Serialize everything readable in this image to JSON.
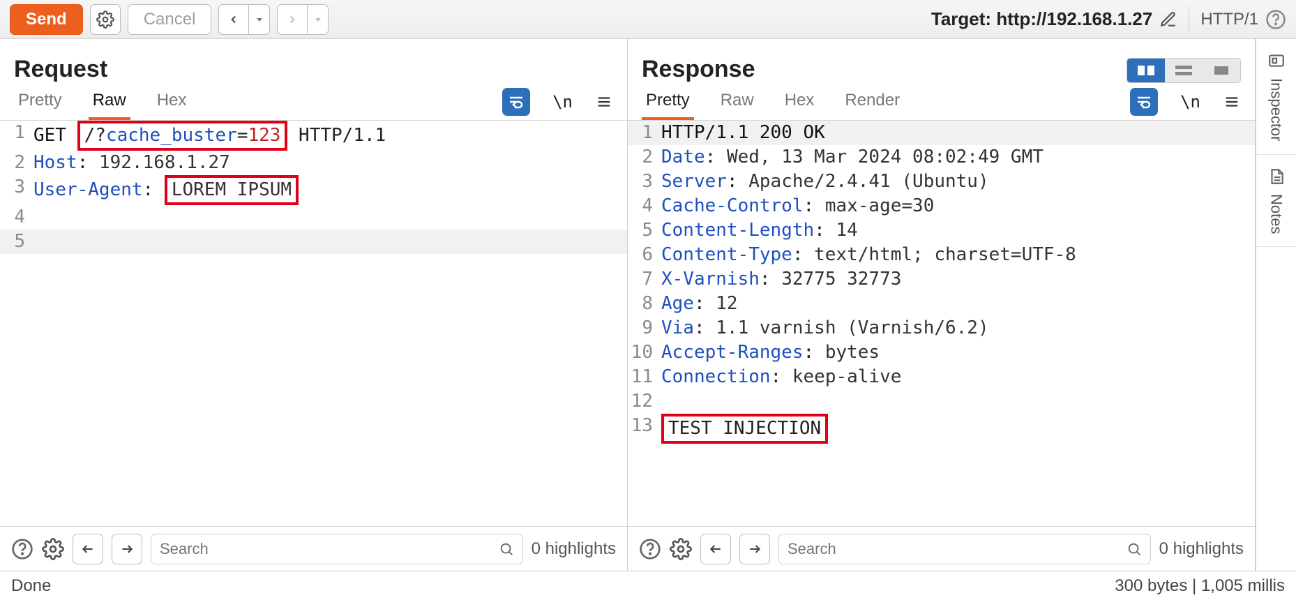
{
  "toolbar": {
    "send_label": "Send",
    "cancel_label": "Cancel",
    "target_prefix": "Target: ",
    "target_url": "http://192.168.1.27",
    "http_version": "HTTP/1"
  },
  "request": {
    "title": "Request",
    "tabs": {
      "pretty": "Pretty",
      "raw": "Raw",
      "hex": "Hex"
    },
    "active_tab": "Raw",
    "escape_label": "\\n",
    "lines": [
      {
        "n": 1,
        "segments": [
          {
            "t": "GET ",
            "cls": "kw-method"
          },
          {
            "hl": true,
            "segments": [
              {
                "t": "/?",
                "cls": ""
              },
              {
                "t": "cache_buster",
                "cls": "kw-url"
              },
              {
                "t": "=",
                "cls": ""
              },
              {
                "t": "123",
                "cls": "kw-num"
              }
            ]
          },
          {
            "t": " HTTP/1.1",
            "cls": ""
          }
        ]
      },
      {
        "n": 2,
        "segments": [
          {
            "t": "Host",
            "cls": "kw-header"
          },
          {
            "t": ": ",
            "cls": ""
          },
          {
            "t": "192.168.1.27",
            "cls": "kw-val"
          }
        ]
      },
      {
        "n": 3,
        "segments": [
          {
            "t": "User-Agent",
            "cls": "kw-header"
          },
          {
            "t": ": ",
            "cls": ""
          },
          {
            "hl": true,
            "segments": [
              {
                "t": "LOREM IPSUM",
                "cls": "kw-val"
              }
            ]
          }
        ]
      },
      {
        "n": 4,
        "segments": []
      },
      {
        "n": 5,
        "segments": [],
        "alt": true
      }
    ],
    "search_placeholder": "Search",
    "highlight_count": "0 highlights"
  },
  "response": {
    "title": "Response",
    "tabs": {
      "pretty": "Pretty",
      "raw": "Raw",
      "hex": "Hex",
      "render": "Render"
    },
    "active_tab": "Pretty",
    "escape_label": "\\n",
    "lines": [
      {
        "n": 1,
        "alt": true,
        "segments": [
          {
            "t": "HTTP/1.1 200 OK",
            "cls": "kw-status"
          }
        ]
      },
      {
        "n": 2,
        "segments": [
          {
            "t": "Date",
            "cls": "kw-header"
          },
          {
            "t": ": ",
            "cls": ""
          },
          {
            "t": "Wed, 13 Mar 2024 08:02:49 GMT",
            "cls": "kw-val"
          }
        ]
      },
      {
        "n": 3,
        "segments": [
          {
            "t": "Server",
            "cls": "kw-header"
          },
          {
            "t": ": ",
            "cls": ""
          },
          {
            "t": "Apache/2.4.41 (Ubuntu)",
            "cls": "kw-val"
          }
        ]
      },
      {
        "n": 4,
        "segments": [
          {
            "t": "Cache-Control",
            "cls": "kw-header"
          },
          {
            "t": ": ",
            "cls": ""
          },
          {
            "t": "max-age=30",
            "cls": "kw-val"
          }
        ]
      },
      {
        "n": 5,
        "segments": [
          {
            "t": "Content-Length",
            "cls": "kw-header"
          },
          {
            "t": ": ",
            "cls": ""
          },
          {
            "t": "14",
            "cls": "kw-val"
          }
        ]
      },
      {
        "n": 6,
        "segments": [
          {
            "t": "Content-Type",
            "cls": "kw-header"
          },
          {
            "t": ": ",
            "cls": ""
          },
          {
            "t": "text/html; charset=UTF-8",
            "cls": "kw-val"
          }
        ]
      },
      {
        "n": 7,
        "segments": [
          {
            "t": "X-Varnish",
            "cls": "kw-header"
          },
          {
            "t": ": ",
            "cls": ""
          },
          {
            "t": "32775 32773",
            "cls": "kw-val"
          }
        ]
      },
      {
        "n": 8,
        "segments": [
          {
            "t": "Age",
            "cls": "kw-header"
          },
          {
            "t": ": ",
            "cls": ""
          },
          {
            "t": "12",
            "cls": "kw-val"
          }
        ]
      },
      {
        "n": 9,
        "segments": [
          {
            "t": "Via",
            "cls": "kw-header"
          },
          {
            "t": ": ",
            "cls": ""
          },
          {
            "t": "1.1 varnish (Varnish/6.2)",
            "cls": "kw-val"
          }
        ]
      },
      {
        "n": 10,
        "segments": [
          {
            "t": "Accept-Ranges",
            "cls": "kw-header"
          },
          {
            "t": ": ",
            "cls": ""
          },
          {
            "t": "bytes",
            "cls": "kw-val"
          }
        ]
      },
      {
        "n": 11,
        "segments": [
          {
            "t": "Connection",
            "cls": "kw-header"
          },
          {
            "t": ": ",
            "cls": ""
          },
          {
            "t": "keep-alive",
            "cls": "kw-val"
          }
        ]
      },
      {
        "n": 12,
        "segments": []
      },
      {
        "n": 13,
        "segments": [
          {
            "hl": true,
            "segments": [
              {
                "t": "TEST INJECTION",
                "cls": ""
              }
            ]
          }
        ]
      }
    ],
    "search_placeholder": "Search",
    "highlight_count": "0 highlights"
  },
  "sidebar": {
    "inspector": "Inspector",
    "notes": "Notes"
  },
  "status": {
    "done": "Done",
    "metrics": "300 bytes | 1,005 millis"
  }
}
